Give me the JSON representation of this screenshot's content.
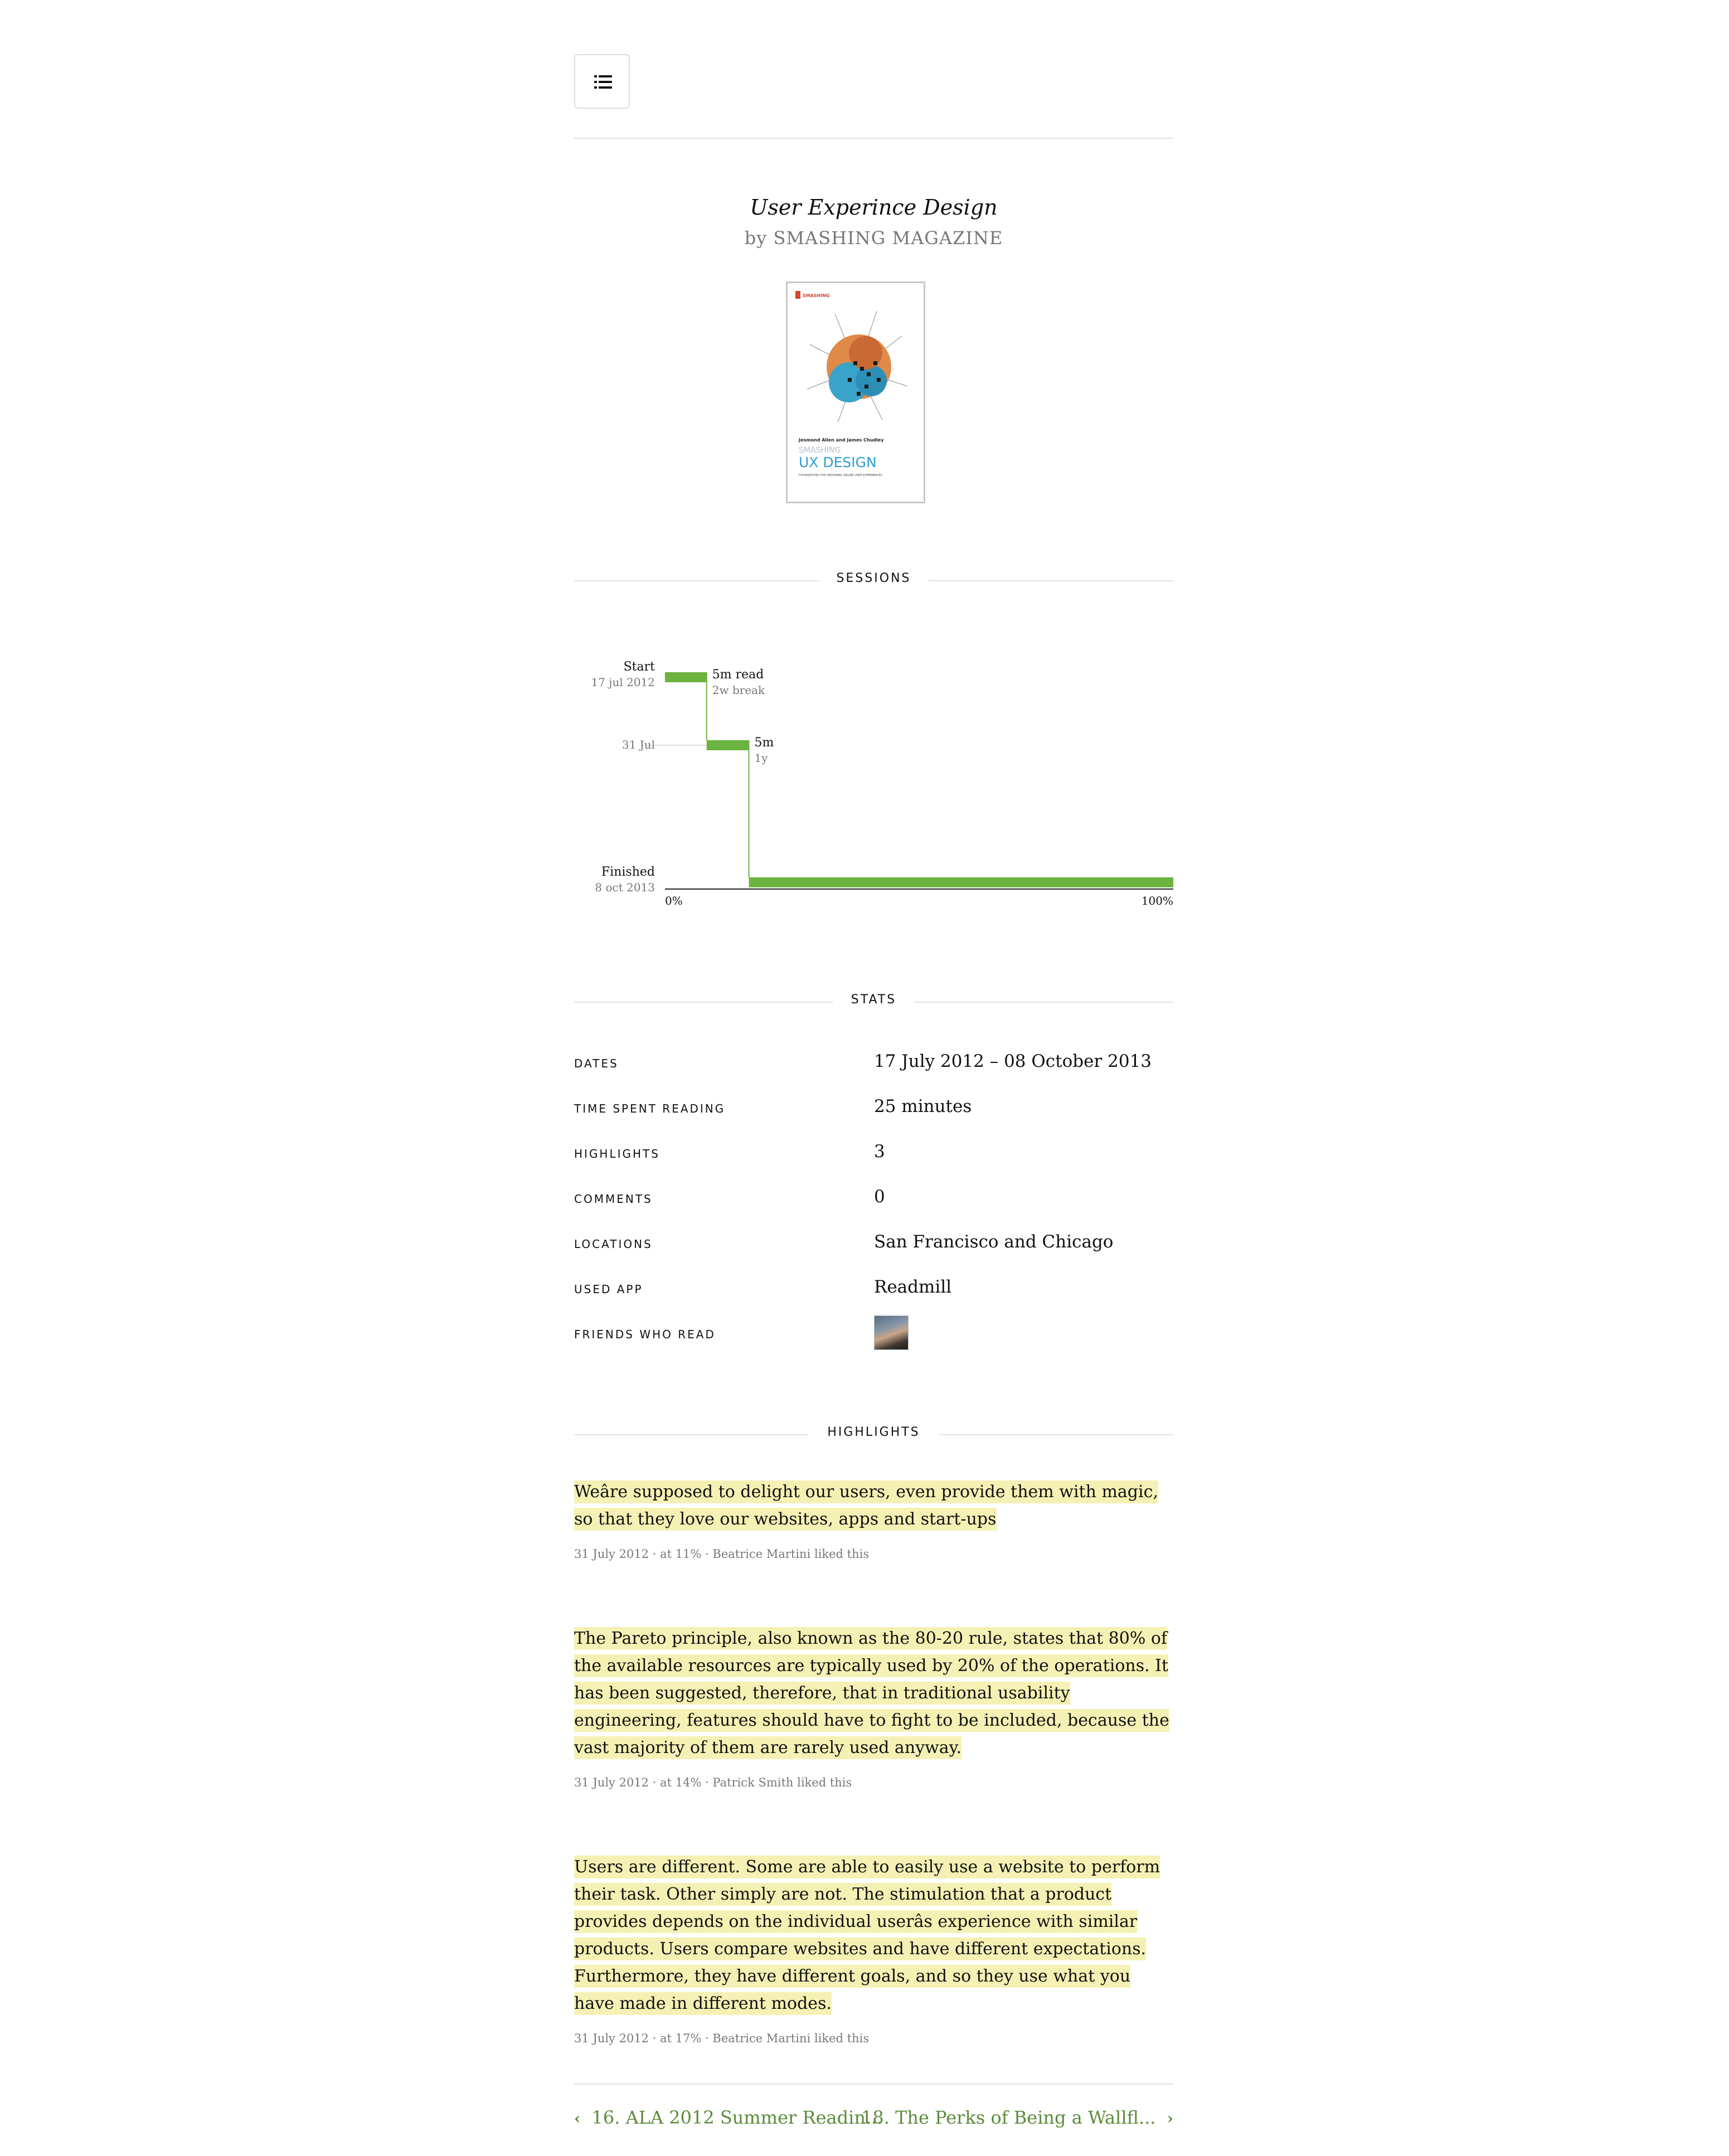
{
  "book": {
    "title": "User Experince Design",
    "author": "by SMASHING MAGAZINE",
    "cover": {
      "publisher_mark": "SMASHING",
      "authors": "Jesmond Allen and James Chudley",
      "series": "SMASHING",
      "title": "UX DESIGN",
      "subtitle": "FOUNDATIONS FOR DESIGNING ONLINE USER EXPERIENCES"
    }
  },
  "sections": {
    "sessions": "SESSIONS",
    "stats": "STATS",
    "highlights": "HIGHLIGHTS"
  },
  "chart_data": {
    "type": "step-timeline",
    "x_ticks": [
      "0%",
      "100%"
    ],
    "xlim": [
      0,
      100
    ],
    "y_markers": [
      {
        "label": "Start",
        "sublabel": "17 jul 2012"
      },
      {
        "label": "",
        "sublabel": "31 Jul"
      },
      {
        "label": "Finished",
        "sublabel": "8 oct 2013"
      }
    ],
    "sessions": [
      {
        "start_pct": 0,
        "end_pct": 8.2,
        "read_label": "5m read",
        "gap_label": "2w break"
      },
      {
        "start_pct": 8.2,
        "end_pct": 16.5,
        "read_label": "5m",
        "gap_label": "1y"
      },
      {
        "start_pct": 16.5,
        "end_pct": 100,
        "read_label": "",
        "gap_label": ""
      }
    ],
    "bar_color": "#6db33f"
  },
  "stats": [
    {
      "label": "DATES",
      "value": "17 July 2012 – 08 October 2013"
    },
    {
      "label": "TIME SPENT READING",
      "value": "25 minutes"
    },
    {
      "label": "HIGHLIGHTS",
      "value": "3"
    },
    {
      "label": "COMMENTS",
      "value": "0"
    },
    {
      "label": "LOCATIONS",
      "value": "San Francisco and Chicago"
    },
    {
      "label": "USED APP",
      "value": "Readmill"
    },
    {
      "label": "FRIENDS WHO READ",
      "value": ""
    }
  ],
  "highlights": [
    {
      "text": "Weâre supposed to delight our users, even provide them with magic, so that they love our websites, apps and start-ups",
      "meta": "31 July 2012 · at 11% · Beatrice Martini liked this"
    },
    {
      "text": "The Pareto principle, also known as the 80-20 rule, states that 80% of the available resources are typically used by 20% of the operations. It has been suggested, therefore, that in traditional usability engineering, features should have to fight to be included, because the vast majority of them are rarely used anyway.",
      "meta": "31 July 2012 · at 14% · Patrick Smith liked this"
    },
    {
      "text": "Users are different. Some are able to easily use a website to perform their task. Other simply are not. The stimulation that a product provides depends on the individual userâs experience with similar products. Users compare websites and have different expectations. Furthermore, they have different goals, and so they use what you have made in different modes.",
      "meta": "31 July 2012 · at 17% · Beatrice Martini liked this"
    }
  ],
  "pager": {
    "prev_label": "16. ALA 2012 Summer Readin...",
    "next_label": "18. The Perks of Being a Wallfl...",
    "prev_icon": "chevron-left-icon",
    "next_icon": "chevron-right-icon"
  },
  "colors": {
    "accent_green": "#6db33f",
    "link_green": "#5a8c3a",
    "highlight_yellow": "#f5f1b4"
  }
}
